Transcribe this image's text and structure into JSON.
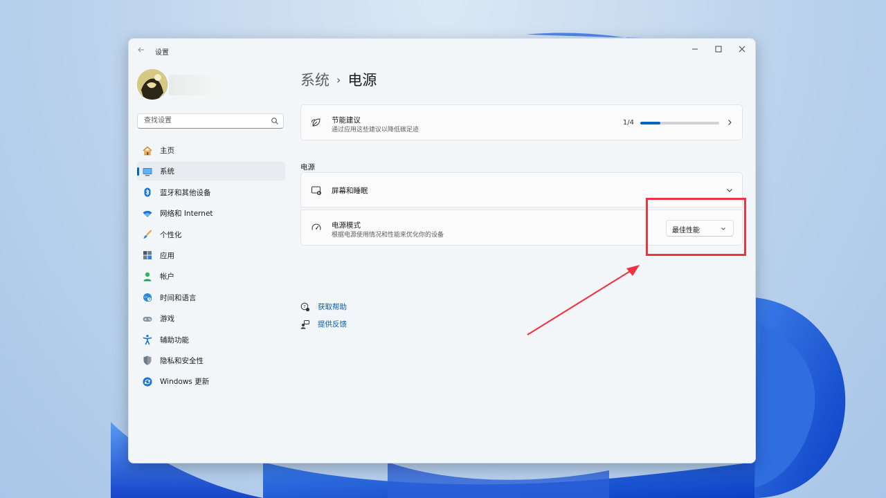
{
  "window": {
    "app_title": "设置",
    "user_avatar_alt": "user avatar"
  },
  "search": {
    "placeholder": "查找设置",
    "icon": "search-icon"
  },
  "sidebar": {
    "items": [
      {
        "label": "主页",
        "icon": "home-icon",
        "selected": false
      },
      {
        "label": "系统",
        "icon": "monitor-icon",
        "selected": true
      },
      {
        "label": "蓝牙和其他设备",
        "icon": "bluetooth-icon",
        "selected": false
      },
      {
        "label": "网络和 Internet",
        "icon": "wifi-icon",
        "selected": false
      },
      {
        "label": "个性化",
        "icon": "brush-icon",
        "selected": false
      },
      {
        "label": "应用",
        "icon": "apps-icon",
        "selected": false
      },
      {
        "label": "帐户",
        "icon": "person-icon",
        "selected": false
      },
      {
        "label": "时间和语言",
        "icon": "globe-clock-icon",
        "selected": false
      },
      {
        "label": "游戏",
        "icon": "gamepad-icon",
        "selected": false
      },
      {
        "label": "辅助功能",
        "icon": "accessibility-icon",
        "selected": false
      },
      {
        "label": "隐私和安全性",
        "icon": "shield-icon",
        "selected": false
      },
      {
        "label": "Windows 更新",
        "icon": "update-icon",
        "selected": false
      }
    ]
  },
  "breadcrumb": {
    "parent": "系统",
    "separator": "›",
    "current": "电源"
  },
  "energy_card": {
    "title": "节能建议",
    "subtitle": "通过应用这些建议以降低碳足迹",
    "progress_text": "1/4",
    "progress_fraction": 0.25,
    "icon": "leaf-icon"
  },
  "power_section": {
    "title": "电源",
    "screen_sleep": {
      "title": "屏幕和睡眠",
      "icon": "screen-sleep-icon"
    },
    "power_mode": {
      "title": "电源模式",
      "subtitle": "根据电源使用情况和性能来优化你的设备",
      "selected_value": "最佳性能",
      "icon": "gauge-icon"
    }
  },
  "links": {
    "help": "获取帮助",
    "feedback": "提供反馈"
  },
  "colors": {
    "accent": "#0067c0",
    "link": "#005fb8",
    "annotation": "#ef3340"
  }
}
